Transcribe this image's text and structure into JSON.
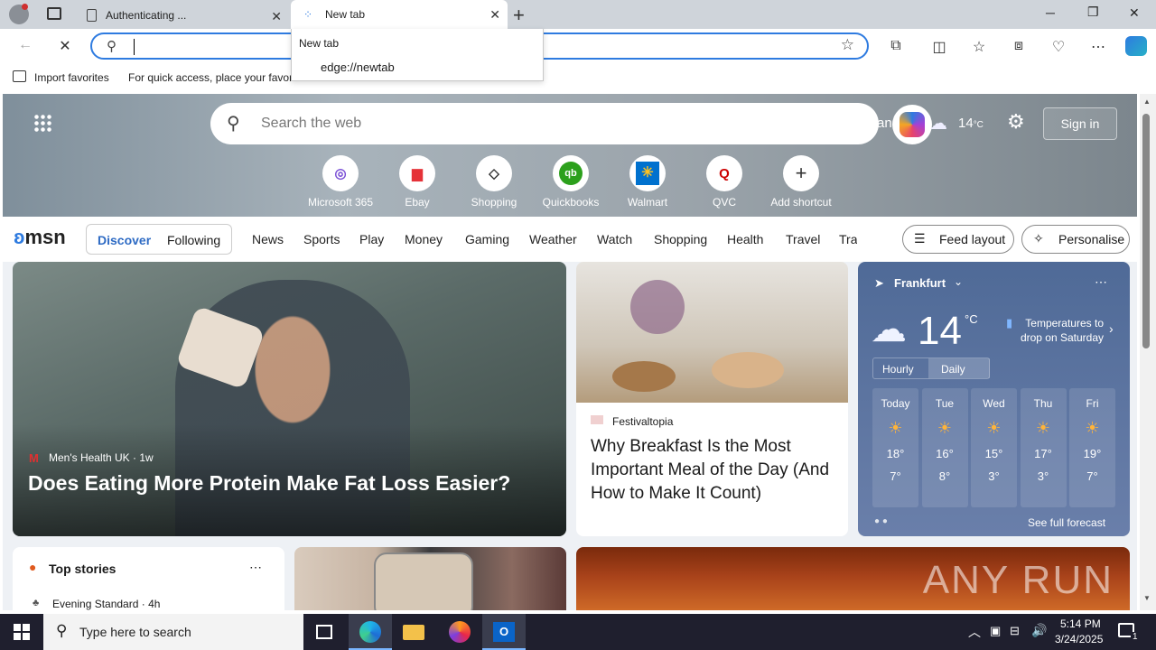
{
  "browser": {
    "tabs": [
      {
        "title": "Authenticating ..."
      },
      {
        "title": "New tab"
      }
    ],
    "address_value": "",
    "dropdown": {
      "header": "New tab",
      "item": "edge://newtab"
    },
    "favorites": {
      "import": "Import favorites",
      "hint": "For quick access, place your favori"
    }
  },
  "page": {
    "search_placeholder": "Search the web",
    "partial_text": "an",
    "temp_hero": "14",
    "temp_unit": "°C",
    "sign_in": "Sign in",
    "shortcuts": [
      {
        "label": "Microsoft 365"
      },
      {
        "label": "Ebay"
      },
      {
        "label": "Shopping"
      },
      {
        "label": "Quickbooks"
      },
      {
        "label": "Walmart"
      },
      {
        "label": "QVC"
      },
      {
        "label": "Add shortcut"
      }
    ],
    "msn_logo": "msn",
    "nav_tabs": [
      "Discover",
      "Following"
    ],
    "nav_links": [
      "News",
      "Sports",
      "Play",
      "Money",
      "Gaming",
      "Weather",
      "Watch",
      "Shopping",
      "Health",
      "Travel",
      "Tra"
    ],
    "feed_layout": "Feed layout",
    "personalise": "Personalise",
    "hero_card": {
      "source": "Men's Health UK",
      "age": "· 1w",
      "headline": "Does Eating More Protein Make Fat Loss Easier?"
    },
    "card2": {
      "source": "Festivaltopia",
      "headline": "Why Breakfast Is the Most Important Meal of the Day (And How to Make It Count)"
    },
    "weather": {
      "city": "Frankfurt",
      "temp": "14",
      "unit": "°C",
      "alert": "Temperatures to drop on Saturday",
      "tabs": [
        "Hourly",
        "Daily"
      ],
      "days": [
        {
          "day": "Today",
          "hi": "18°",
          "lo": "7°"
        },
        {
          "day": "Tue",
          "hi": "16°",
          "lo": "8°"
        },
        {
          "day": "Wed",
          "hi": "15°",
          "lo": "3°"
        },
        {
          "day": "Thu",
          "hi": "17°",
          "lo": "3°"
        },
        {
          "day": "Fri",
          "hi": "19°",
          "lo": "7°"
        }
      ],
      "see_full": "See full forecast"
    },
    "top_stories": {
      "title": "Top stories",
      "source": "Evening Standard",
      "age": "· 4h"
    },
    "watermark": "ANY RUN"
  },
  "taskbar": {
    "search_placeholder": "Type here to search",
    "time": "5:14 PM",
    "date": "3/24/2025",
    "notif_count": "1"
  },
  "colors": {
    "accent": "#2e7be0",
    "taskbar": "#1f1f2e",
    "weather_bg": "#5a7196"
  }
}
